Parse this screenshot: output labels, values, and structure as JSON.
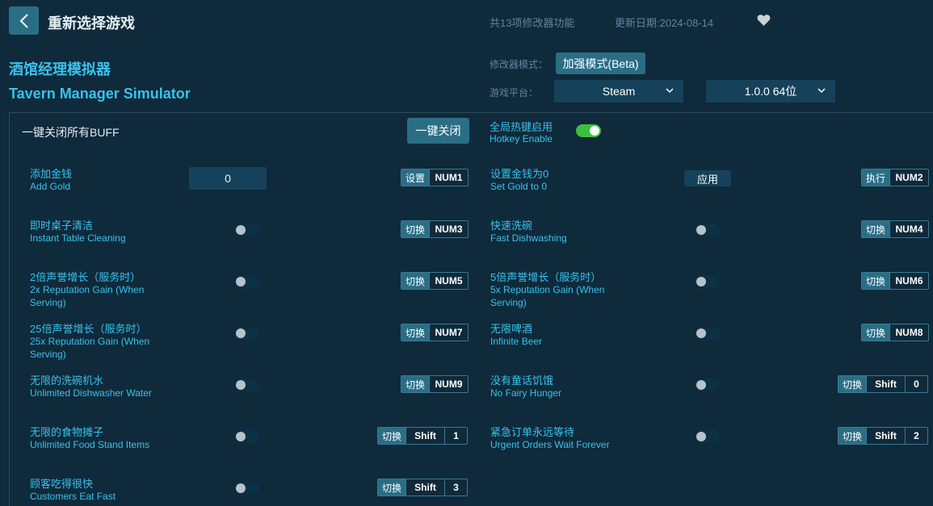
{
  "header": {
    "title": "重新选择游戏",
    "feature_count": "共13项修改器功能",
    "update_date": "更新日期:2024-08-14"
  },
  "game": {
    "name_cn": "酒馆经理模拟器",
    "name_en": "Tavern Manager Simulator"
  },
  "settings": {
    "mode_label": "修改器模式：",
    "mode_value": "加强模式(Beta)",
    "platform_label": "游戏平台：",
    "platform_value": "Steam",
    "version_value": "1.0.0 64位"
  },
  "controls": {
    "close_all_label": "一键关闭所有BUFF",
    "close_all_button": "一键关闭",
    "hotkey_cn": "全局热键启用",
    "hotkey_en": "Hotkey Enable",
    "hotkey_enabled": true
  },
  "features": [
    {
      "cn": "添加金钱",
      "en": "Add Gold",
      "input_value": "0",
      "action": "设置",
      "keys": [
        "NUM1"
      ]
    },
    {
      "cn": "设置金钱为0",
      "en": "Set Gold to 0",
      "button": "应用",
      "action": "执行",
      "keys": [
        "NUM2"
      ]
    },
    {
      "cn": "即时桌子清洁",
      "en": "Instant Table Cleaning",
      "action": "切换",
      "keys": [
        "NUM3"
      ]
    },
    {
      "cn": "快速洗碗",
      "en": "Fast Dishwashing",
      "action": "切换",
      "keys": [
        "NUM4"
      ]
    },
    {
      "cn": "2倍声誉增长（服务时）",
      "en": "2x Reputation Gain (When Serving)",
      "action": "切换",
      "keys": [
        "NUM5"
      ]
    },
    {
      "cn": "5倍声誉增长（服务时）",
      "en": "5x Reputation Gain (When Serving)",
      "action": "切换",
      "keys": [
        "NUM6"
      ]
    },
    {
      "cn": "25倍声誉增长（服务时）",
      "en": "25x Reputation Gain (When Serving)",
      "action": "切换",
      "keys": [
        "NUM7"
      ]
    },
    {
      "cn": "无限啤酒",
      "en": "Infinite Beer",
      "action": "切换",
      "keys": [
        "NUM8"
      ]
    },
    {
      "cn": "无限的洗碗机水",
      "en": "Unlimited Dishwasher Water",
      "action": "切换",
      "keys": [
        "NUM9"
      ]
    },
    {
      "cn": "没有童话饥饿",
      "en": "No Fairy Hunger",
      "action": "切换",
      "keys": [
        "Shift",
        "0"
      ]
    },
    {
      "cn": "无限的食物摊子",
      "en": "Unlimited Food Stand Items",
      "action": "切换",
      "keys": [
        "Shift",
        "1"
      ]
    },
    {
      "cn": "紧急订单永远等待",
      "en": "Urgent Orders Wait Forever",
      "action": "切换",
      "keys": [
        "Shift",
        "2"
      ]
    },
    {
      "cn": "顾客吃得很快",
      "en": "Customers Eat Fast",
      "action": "切换",
      "keys": [
        "Shift",
        "3"
      ]
    }
  ]
}
